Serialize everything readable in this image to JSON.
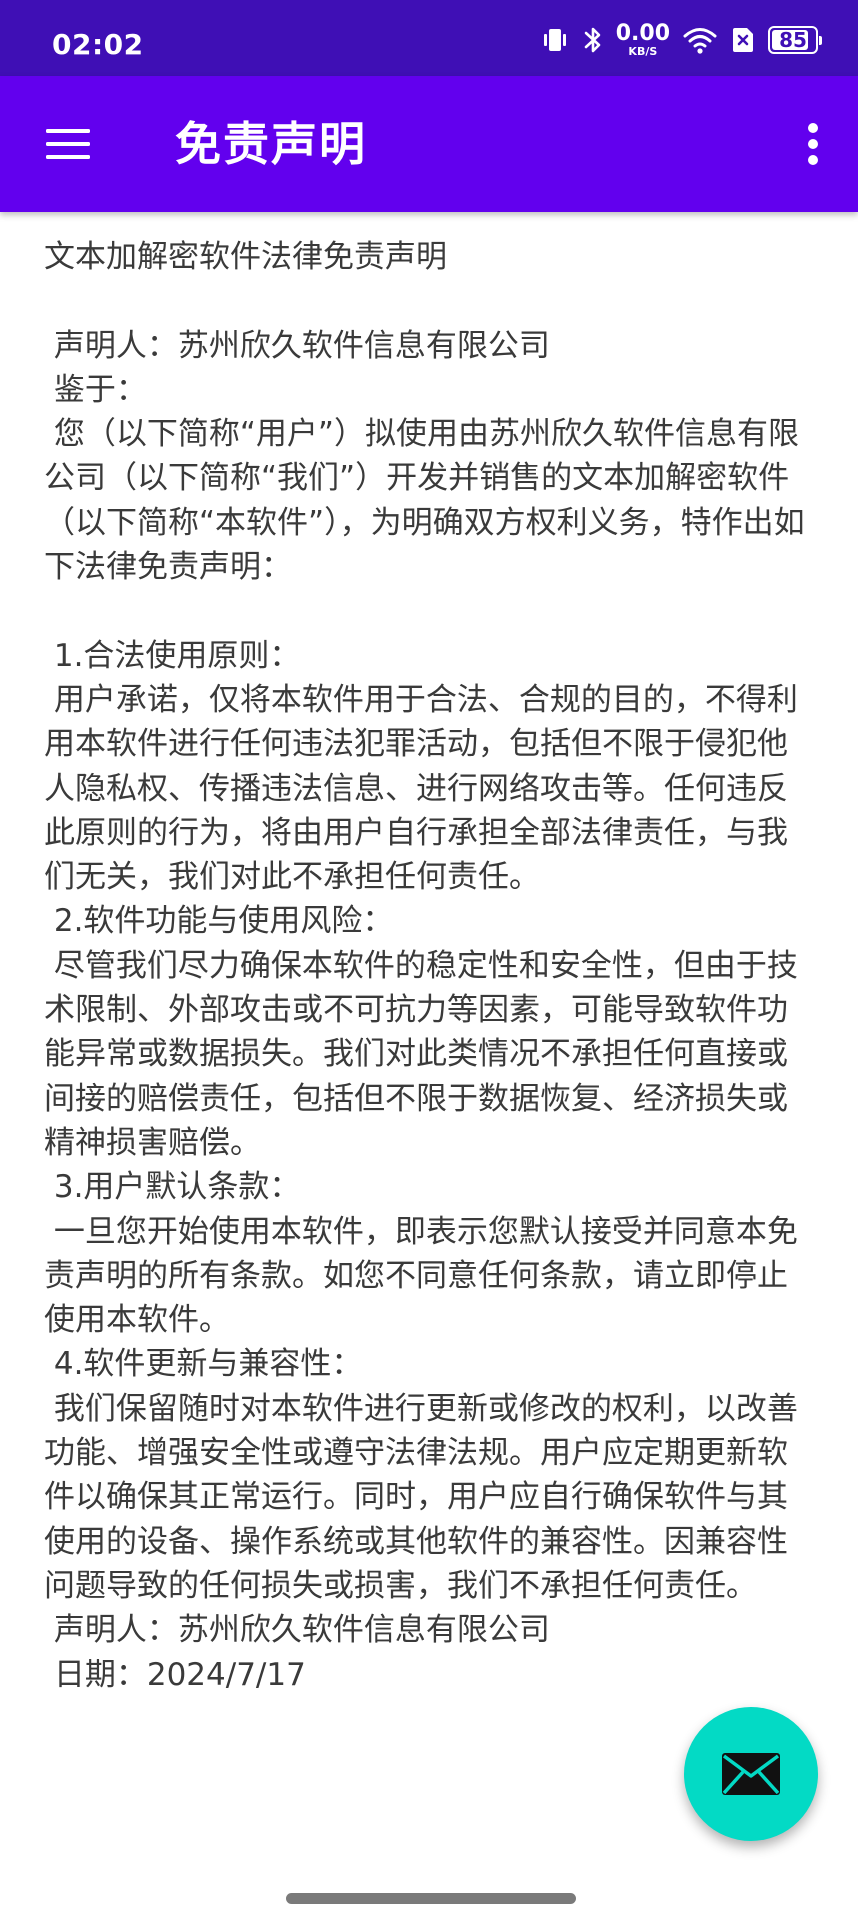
{
  "status_bar": {
    "time": "02:02",
    "net_speed_value": "0.00",
    "net_speed_unit": "KB/S",
    "battery_level": "85",
    "battery_fraction": 0.85,
    "icons": [
      "vibrate-icon",
      "bluetooth-icon",
      "wifi-icon",
      "sim-off-icon",
      "battery-icon"
    ]
  },
  "app_bar": {
    "title": "免责声明",
    "menu_icon": "hamburger-menu-icon",
    "overflow_icon": "more-vert-icon",
    "background": "#6200ee"
  },
  "disclaimer": {
    "heading": "文本加解密软件法律免责声明",
    "declarant": " 声明人：苏州欣久软件信息有限公司",
    "whereas": " 鉴于：",
    "intro": " 您（以下简称“用户”）拟使用由苏州欣久软件信息有限公司（以下简称“我们”）开发并销售的文本加解密软件（以下简称“本软件”），为明确双方权利义务，特作出如下法律免责声明：",
    "sections": [
      {
        "title": " 1.合法使用原则：",
        "body": " 用户承诺，仅将本软件用于合法、合规的目的，不得利用本软件进行任何违法犯罪活动，包括但不限于侵犯他人隐私权、传播违法信息、进行网络攻击等。任何违反此原则的行为，将由用户自行承担全部法律责任，与我们无关，我们对此不承担任何责任。"
      },
      {
        "title": " 2.软件功能与使用风险：",
        "body": " 尽管我们尽力确保本软件的稳定性和安全性，但由于技术限制、外部攻击或不可抗力等因素，可能导致软件功能异常或数据损失。我们对此类情况不承担任何直接或间接的赔偿责任，包括但不限于数据恢复、经济损失或精神损害赔偿。"
      },
      {
        "title": " 3.用户默认条款：",
        "body": " 一旦您开始使用本软件，即表示您默认接受并同意本免责声明的所有条款。如您不同意任何条款，请立即停止使用本软件。"
      },
      {
        "title": " 4.软件更新与兼容性：",
        "body": " 我们保留随时对本软件进行更新或修改的权利，以改善功能、增强安全性或遵守法律法规。用户应定期更新软件以确保其正常运行。同时，用户应自行确保软件与其使用的设备、操作系统或其他软件的兼容性。因兼容性问题导致的任何损失或损害，我们不承担任何责任。"
      }
    ],
    "signature": " 声明人：苏州欣久软件信息有限公司",
    "date": " 日期：2024/7/17"
  },
  "fab": {
    "icon": "email-icon",
    "color": "#03dac5"
  },
  "colors": {
    "status_bar": "#3f0fb5",
    "text": "#3a3a3a"
  }
}
